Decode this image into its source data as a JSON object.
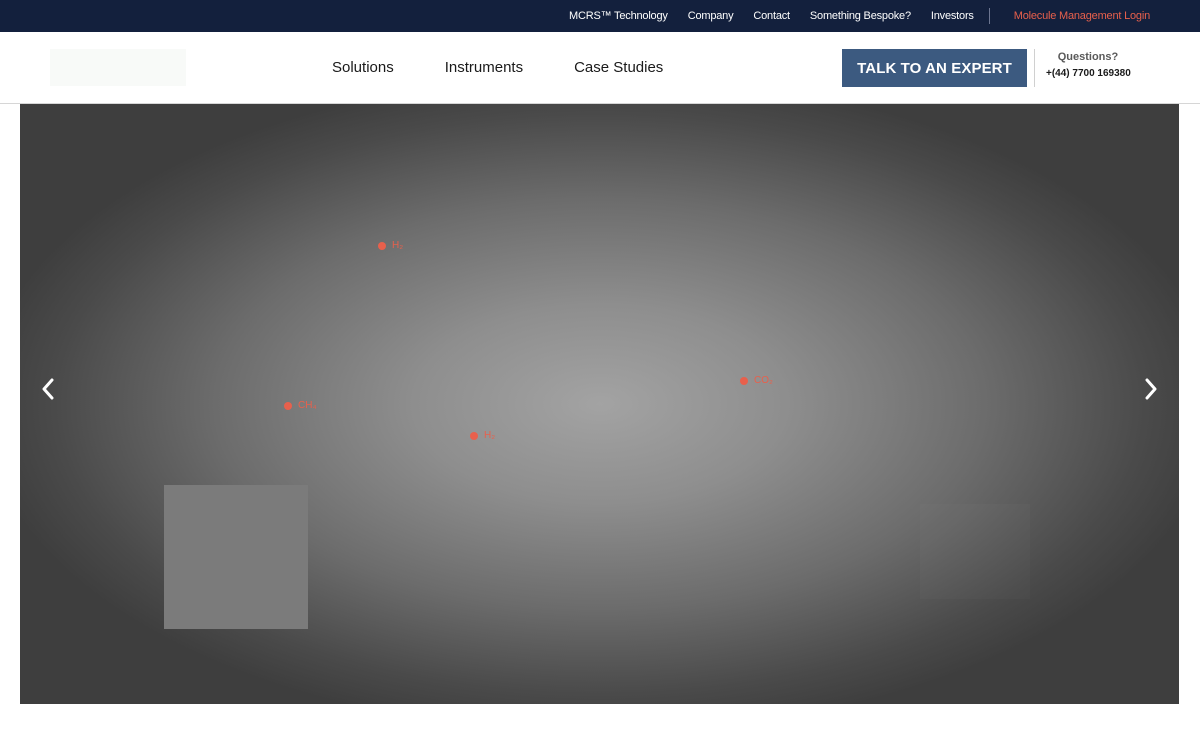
{
  "topbar": {
    "links": [
      "MCRS™ Technology",
      "Company",
      "Contact",
      "Something Bespoke?",
      "Investors"
    ],
    "login": "Molecule Management Login"
  },
  "header": {
    "nav": [
      "Solutions",
      "Instruments",
      "Case Studies"
    ],
    "cta": "TALK TO AN EXPERT",
    "questions_label": "Questions?",
    "phone": "+(44) 7700 169380"
  },
  "hero": {
    "hotspots": [
      {
        "label": "H₂"
      },
      {
        "label": "CH₄"
      },
      {
        "label": "H₂"
      },
      {
        "label": "CO₂"
      }
    ],
    "icons": {
      "prev": "chevron-left-icon",
      "next": "chevron-right-icon"
    }
  },
  "colors": {
    "topbar_bg": "#13203d",
    "accent": "#e8604c",
    "cta_bg": "#3c5a80"
  }
}
